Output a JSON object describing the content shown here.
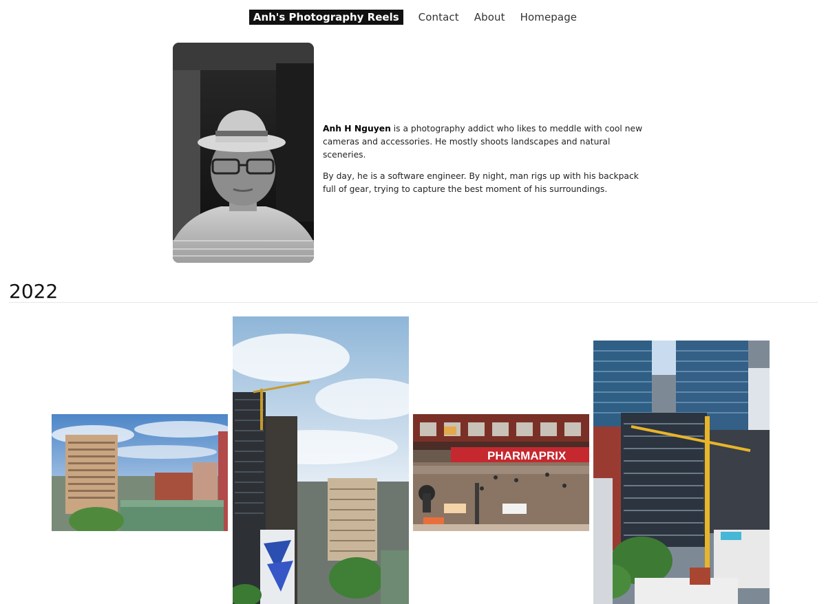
{
  "nav": {
    "brand": "Anh's Photography Reels",
    "links": [
      "Contact",
      "About",
      "Homepage"
    ]
  },
  "bio": {
    "name": "Anh H Nguyen",
    "paragraph1_rest": " is a photography addict who likes to meddle with cool new cameras and accessories. He mostly shoots landscapes and natural sceneries.",
    "paragraph2": "By day, he is a software engineer. By night, man rigs up with his backpack full of gear, trying to capture the best moment of his surroundings."
  },
  "gallery": {
    "year": "2022",
    "storefront_sign": "PHARMAPRIX"
  }
}
